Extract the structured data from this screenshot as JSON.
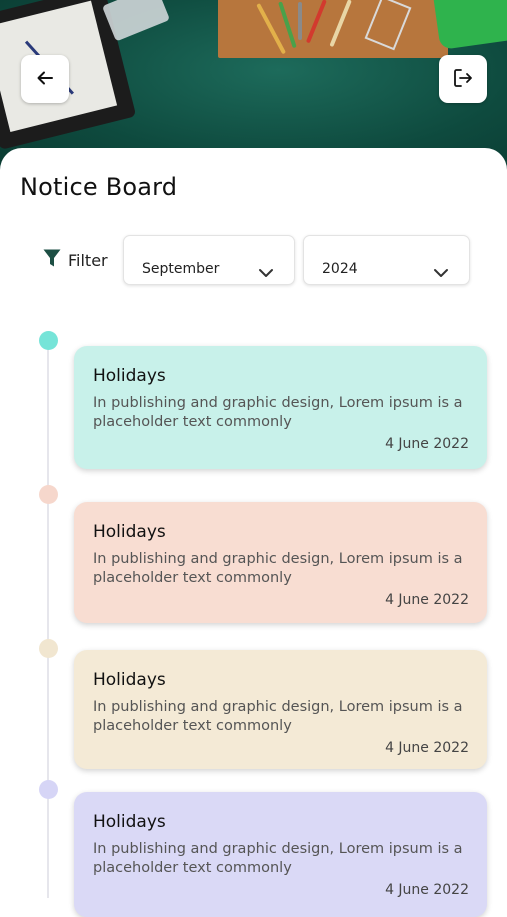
{
  "header": {
    "back_icon": "arrow-left-icon",
    "logout_icon": "logout-icon"
  },
  "page": {
    "title": "Notice Board"
  },
  "filter": {
    "label": "Filter",
    "icon": "funnel-icon",
    "month": "September",
    "year": "2024"
  },
  "notices": [
    {
      "title": "Holidays",
      "body": "In publishing and graphic design, Lorem ipsum is a placeholder text commonly",
      "date": "4 June 2022",
      "color": "#c8f1ea",
      "dot_color": "#76e4d8"
    },
    {
      "title": "Holidays",
      "body": "In publishing and graphic design, Lorem ipsum is a placeholder text commonly",
      "date": "4 June 2022",
      "color": "#f8ddd2",
      "dot_color": "#f6d7cc"
    },
    {
      "title": "Holidays",
      "body": "In publishing and graphic design, Lorem ipsum is a placeholder text commonly",
      "date": "4 June 2022",
      "color": "#f4ead6",
      "dot_color": "#f1e6d0"
    },
    {
      "title": "Holidays",
      "body": "In publishing and graphic design, Lorem ipsum is a placeholder text commonly",
      "date": "4 June 2022",
      "color": "#dad9f6",
      "dot_color": "#d6d5f6"
    }
  ],
  "colors": {
    "accent": "#0e4a3e"
  }
}
